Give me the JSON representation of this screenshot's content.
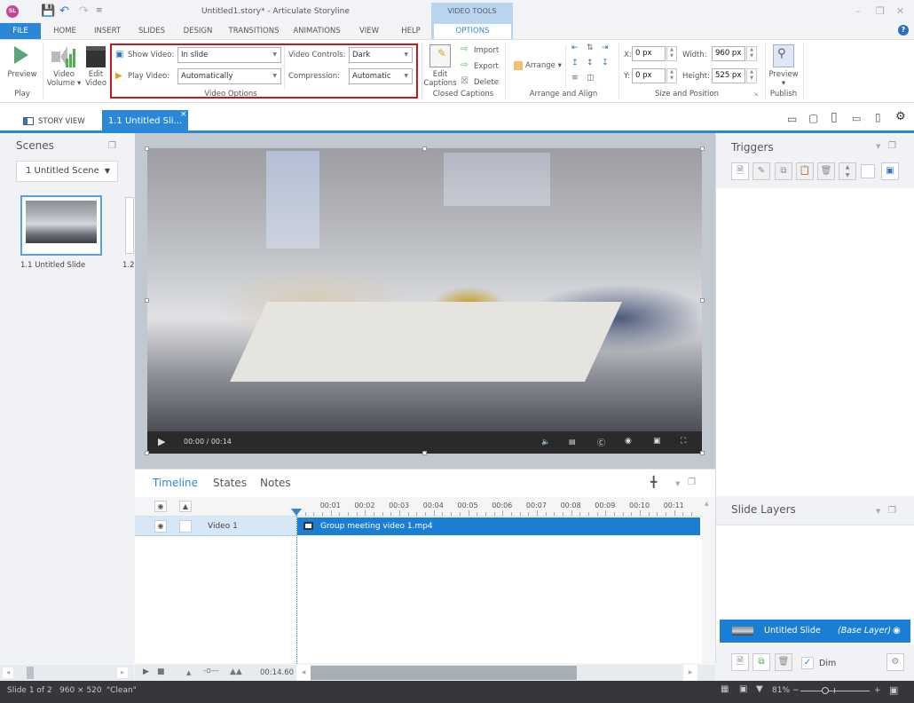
{
  "app": {
    "logo": "SL",
    "title": "Untitled1.story* - Articulate Storyline",
    "quick_access": [
      "save-icon",
      "undo-icon",
      "redo-icon",
      "customize-icon"
    ],
    "window_controls": [
      "–",
      "🗗",
      "✕"
    ]
  },
  "menu_tabs": [
    "FILE",
    "HOME",
    "INSERT",
    "SLIDES",
    "DESIGN",
    "TRANSITIONS",
    "ANIMATIONS",
    "VIEW",
    "HELP"
  ],
  "contextual_tab": {
    "group": "VIDEO TOOLS",
    "tab": "OPTIONS"
  },
  "ribbon": {
    "play": {
      "preview": "Preview",
      "group": "Play"
    },
    "video_volume": [
      "Video",
      "Volume ▾"
    ],
    "edit_video": [
      "Edit",
      "Video"
    ],
    "video_options": {
      "group": "Video Options",
      "show_video_label": "Show Video:",
      "show_video_value": "In slide",
      "play_video_label": "Play Video:",
      "play_video_value": "Automatically",
      "video_controls_label": "Video Controls:",
      "video_controls_value": "Dark",
      "compression_label": "Compression:",
      "compression_value": "Automatic"
    },
    "closed_captions": {
      "group": "Closed Captions",
      "edit": [
        "Edit",
        "Captions"
      ],
      "import": "Import",
      "export": "Export",
      "delete": "Delete"
    },
    "arrange": {
      "group": "Arrange and Align",
      "arrange": "Arrange"
    },
    "size_position": {
      "group": "Size and Position",
      "x_label": "X:",
      "x_value": "0 px",
      "y_label": "Y:",
      "y_value": "0 px",
      "width_label": "Width:",
      "width_value": "960 px",
      "height_label": "Height:",
      "height_value": "525 px"
    },
    "publish": {
      "preview": "Preview",
      "group": "Publish"
    }
  },
  "view_tabs": {
    "story_view": "STORY VIEW",
    "slide_tab": "1.1 Untitled Sli...",
    "close": "×"
  },
  "scenes": {
    "title": "Scenes",
    "dropdown": "1 Untitled Scene",
    "slides": [
      {
        "label": "1.1 Untitled Slide"
      },
      {
        "label": "1.2"
      }
    ]
  },
  "video": {
    "time": "00:00 / 00:14"
  },
  "triggers": {
    "title": "Triggers"
  },
  "timeline": {
    "tabs": [
      "Timeline",
      "States",
      "Notes"
    ],
    "ticks": [
      "00:01",
      "00:02",
      "00:03",
      "00:04",
      "00:05",
      "00:06",
      "00:07",
      "00:08",
      "00:09",
      "00:10",
      "00:11"
    ],
    "row_label": "Video 1",
    "clip": "Group meeting video 1.mp4",
    "duration": "00:14.60"
  },
  "slide_layers": {
    "title": "Slide Layers",
    "base_name": "Untitled Slide",
    "base_tag": "(Base Layer)",
    "dim_label": "Dim",
    "dim_checked": true
  },
  "status": {
    "slide": "Slide 1 of 2",
    "size": "960 × 520",
    "theme": "\"Clean\"",
    "zoom": "81%"
  }
}
